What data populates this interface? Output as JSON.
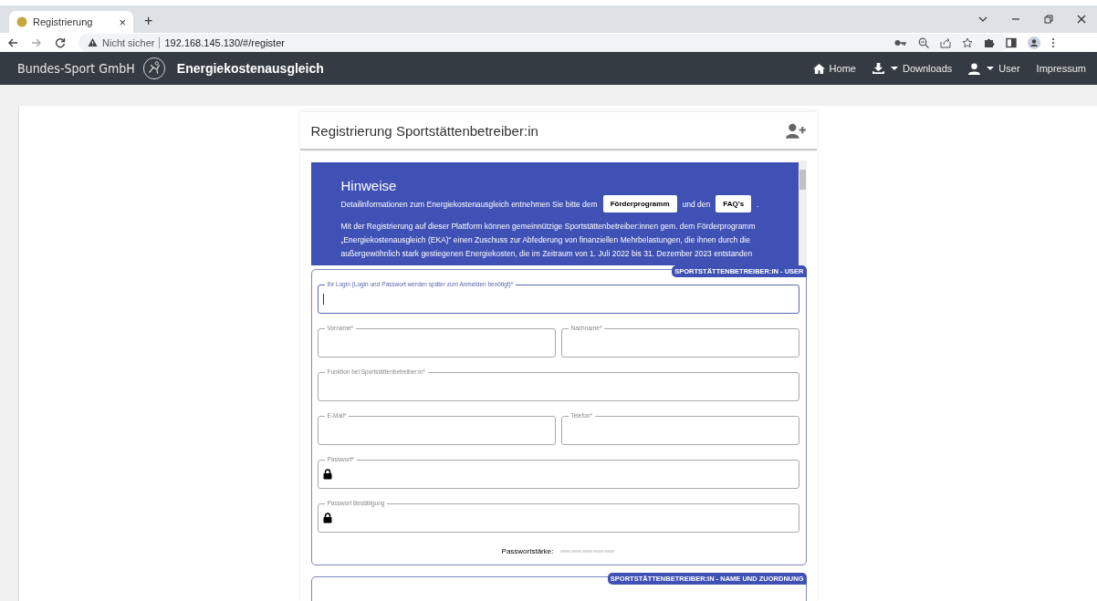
{
  "browser": {
    "tab_title": "Registrierung",
    "tab_close": "×",
    "new_tab": "+",
    "security": "Nicht sicher",
    "url": "192.168.145.130/#/register"
  },
  "navbar": {
    "brand": "Bundes-Sport GmbH",
    "app_title": "Energiekostenausgleich",
    "items": [
      {
        "label": "Home",
        "kind": "home"
      },
      {
        "label": "Downloads",
        "kind": "downloads"
      },
      {
        "label": "User",
        "kind": "user"
      },
      {
        "label": "Impressum",
        "kind": "plain"
      }
    ]
  },
  "card": {
    "title": "Registrierung Sportstättenbetreiber:in",
    "notice": {
      "heading": "Hinweise",
      "intro": "Detailinformationen zum Energiekostenausgleich entnehmen Sie bitte dem",
      "button_1": "Förderprogramm",
      "between": "und den",
      "button_2": "FAQ's",
      "end": ".",
      "paragraph": "Mit der Registrierung auf dieser Plattform können gemeinnützige Sportstättenbetreiber:innen gem. dem Förderprogramm „Energiekostenausgleich (EKA)“ einen Zuschuss zur Abfederung von finanziellen Mehrbelastungen, die ihnen durch die außergewöhnlich stark gestiegenen Energiekosten, die im Zeitraum von 1. Juli 2022 bis 31. Dezember 2023 entstanden"
    },
    "sections": [
      {
        "legend": "SPORTSTÄTTENBETREIBER:IN - USER",
        "rows": [
          [
            {
              "label": "Ihr Login (Login und Passwort werden später zum Anmelden benötigt)*",
              "kind": "text",
              "focused": true
            }
          ],
          [
            {
              "label": "Vorname*",
              "kind": "text",
              "focused": false
            },
            {
              "label": "Nachname*",
              "kind": "text",
              "focused": false
            }
          ],
          [
            {
              "label": "Funktion bei Sportstättenbetreiber:in*",
              "kind": "text",
              "focused": false
            }
          ],
          [
            {
              "label": "E-Mail*",
              "kind": "text",
              "focused": false
            },
            {
              "label": "Telefon*",
              "kind": "text",
              "focused": false
            }
          ],
          [
            {
              "label": "Passwort*",
              "kind": "password",
              "focused": false
            }
          ],
          [
            {
              "label": "Passwort Bestätigung",
              "kind": "password",
              "focused": false
            }
          ]
        ],
        "strength": {
          "label": "Passwortstärke:"
        }
      },
      {
        "legend": "SPORTSTÄTTENBETREIBER:IN - NAME UND ZUORDNUNG"
      }
    ]
  }
}
